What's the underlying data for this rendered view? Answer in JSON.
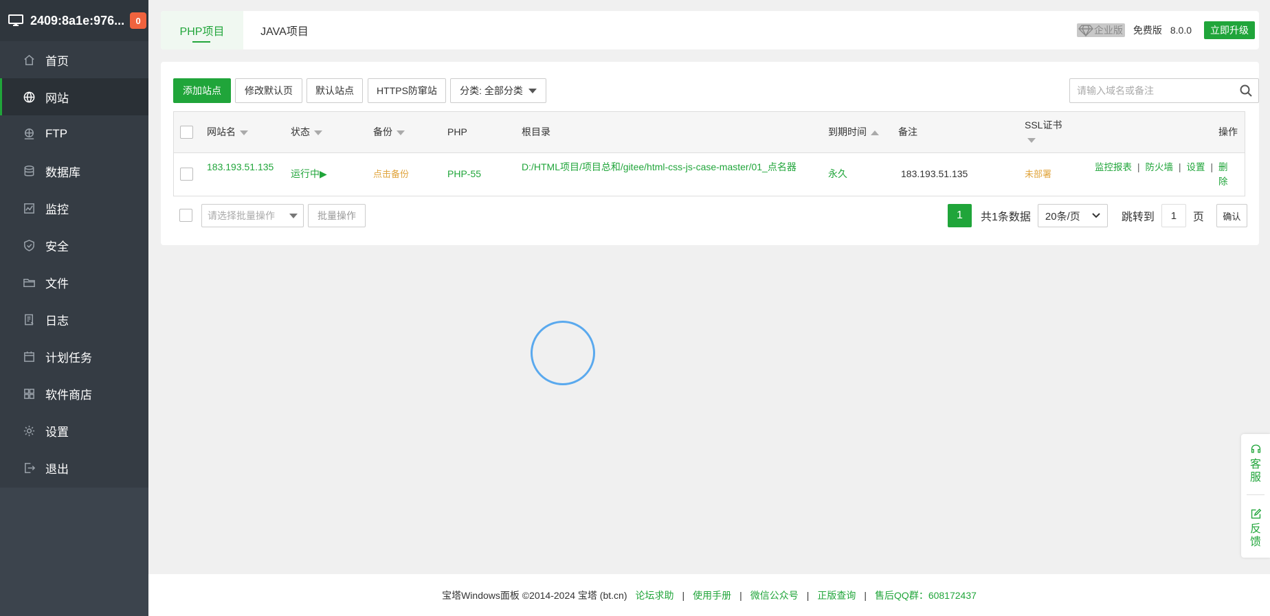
{
  "sidebar": {
    "host": "2409:8a1e:976...",
    "badge": "0",
    "items": [
      {
        "label": "首页",
        "icon": "home-icon"
      },
      {
        "label": "网站",
        "icon": "globe-icon"
      },
      {
        "label": "FTP",
        "icon": "ftp-icon"
      },
      {
        "label": "数据库",
        "icon": "database-icon"
      },
      {
        "label": "监控",
        "icon": "monitor-icon"
      },
      {
        "label": "安全",
        "icon": "shield-icon"
      },
      {
        "label": "文件",
        "icon": "folder-icon"
      },
      {
        "label": "日志",
        "icon": "log-icon"
      },
      {
        "label": "计划任务",
        "icon": "calendar-icon"
      },
      {
        "label": "软件商店",
        "icon": "apps-icon"
      },
      {
        "label": "设置",
        "icon": "gear-icon"
      },
      {
        "label": "退出",
        "icon": "logout-icon"
      }
    ],
    "active_index": 1
  },
  "tabs": {
    "php": "PHP项目",
    "java": "JAVA项目"
  },
  "header": {
    "enterprise": "企业版",
    "free": "免费版",
    "version": "8.0.0",
    "upgrade": "立即升级"
  },
  "toolbar": {
    "add_site": "添加站点",
    "edit_default": "修改默认页",
    "default_site": "默认站点",
    "https_guard": "HTTPS防窜站",
    "category": "分类: 全部分类",
    "search_placeholder": "请输入域名或备注"
  },
  "table": {
    "columns": {
      "name": "网站名",
      "status": "状态",
      "backup": "备份",
      "php": "PHP",
      "root": "根目录",
      "expire": "到期时间",
      "note": "备注",
      "ssl": "SSL证书",
      "actions": "操作"
    },
    "rows": [
      {
        "name": "183.193.51.135",
        "status": "运行中▶",
        "backup": "点击备份",
        "php": "PHP-55",
        "root": "D:/HTML项目/项目总和/gitee/html-css-js-case-master/01_点名器",
        "expire": "永久",
        "note": "183.193.51.135",
        "ssl": "未部署",
        "actions": [
          "监控报表",
          "防火墙",
          "设置",
          "删除"
        ]
      }
    ]
  },
  "batch": {
    "select_placeholder": "请选择批量操作",
    "button": "批量操作"
  },
  "pager": {
    "current": "1",
    "total": "共1条数据",
    "per_page": "20条/页",
    "jump_label": "跳转到",
    "jump_value": "1",
    "page_unit": "页",
    "confirm": "确认"
  },
  "footer": {
    "copyright": "宝塔Windows面板 ©2014-2024 宝塔 (bt.cn)",
    "links": [
      "论坛求助",
      "使用手册",
      "微信公众号",
      "正版查询",
      "售后QQ群：608172437"
    ]
  },
  "float_widget": {
    "service": "客服",
    "feedback": "反馈"
  },
  "colors": {
    "accent": "#20a53a",
    "sidebar": "#3c444d",
    "warning": "#e0a43c",
    "badge": "#f0633e"
  }
}
